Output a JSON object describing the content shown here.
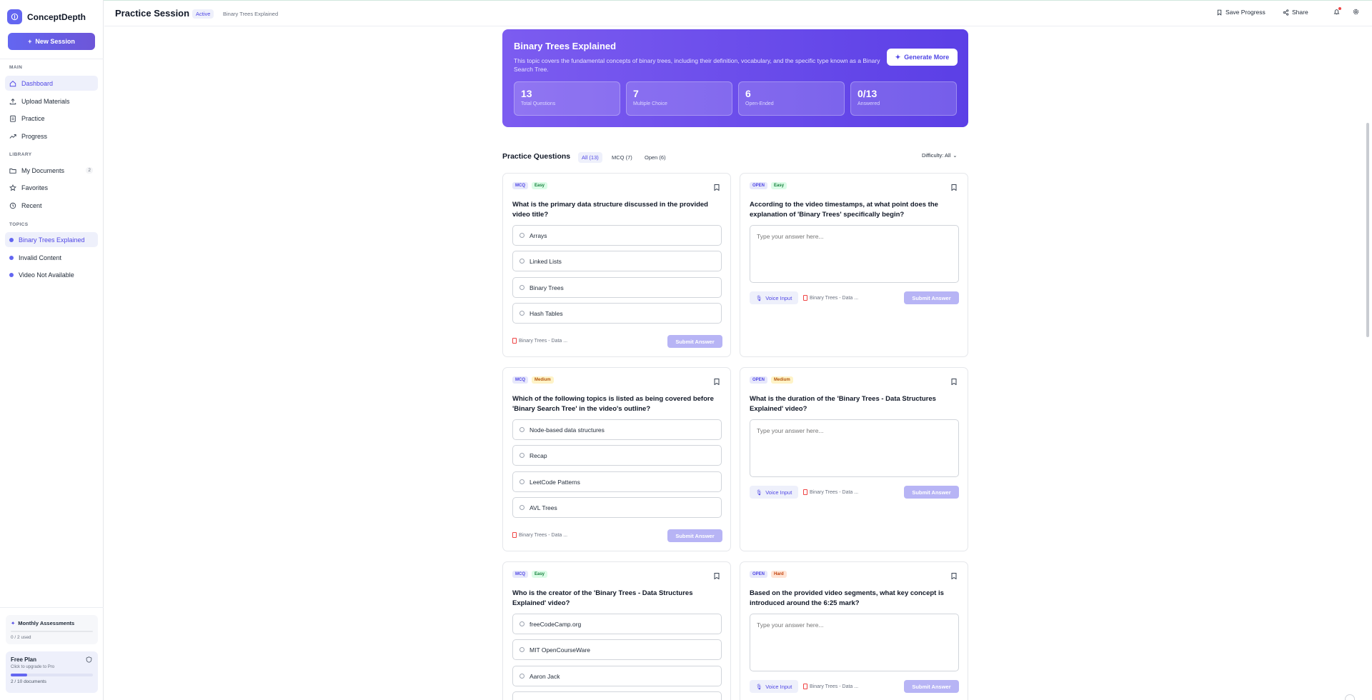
{
  "app": {
    "name": "ConceptDepth"
  },
  "sidebar": {
    "new_session": "New Session",
    "sections": {
      "main": "MAIN",
      "library": "LIBRARY",
      "topics": "TOPICS"
    },
    "main_items": [
      {
        "label": "Dashboard",
        "icon": "home-icon",
        "active": true
      },
      {
        "label": "Upload Materials",
        "icon": "upload-icon"
      },
      {
        "label": "Practice",
        "icon": "clipboard-icon"
      },
      {
        "label": "Progress",
        "icon": "trend-icon"
      }
    ],
    "library_items": [
      {
        "label": "My Documents",
        "icon": "folder-icon",
        "badge": "2"
      },
      {
        "label": "Favorites",
        "icon": "star-icon"
      },
      {
        "label": "Recent",
        "icon": "history-icon"
      }
    ],
    "topics": [
      {
        "label": "Binary Trees Explained",
        "active": true
      },
      {
        "label": "Invalid Content"
      },
      {
        "label": "Video Not Available"
      }
    ],
    "monthly": {
      "title": "Monthly Assessments",
      "usage": "0 / 2 used"
    },
    "plan": {
      "title": "Free Plan",
      "subtitle": "Click to upgrade to Pro",
      "usage": "2 / 10 documents",
      "progress": 0.2
    }
  },
  "header": {
    "title": "Practice Session",
    "status": "Active",
    "crumb": "Binary Trees Explained",
    "save": "Save Progress",
    "share": "Share"
  },
  "hero": {
    "title": "Binary Trees Explained",
    "description": "This topic covers the fundamental concepts of binary trees, including their definition, vocabulary, and the specific type known as a Binary Search Tree.",
    "generate": "Generate More",
    "stats": [
      {
        "value": "13",
        "label": "Total Questions"
      },
      {
        "value": "7",
        "label": "Multiple Choice"
      },
      {
        "value": "6",
        "label": "Open-Ended"
      },
      {
        "value": "0/13",
        "label": "Answered"
      }
    ]
  },
  "questions_header": {
    "title": "Practice Questions",
    "tabs": [
      "All (13)",
      "MCQ (7)",
      "Open (6)"
    ],
    "difficulty": "Difficulty: All"
  },
  "common": {
    "placeholder": "Type your answer here...",
    "voice": "Voice Input",
    "source": "Binary Trees - Data ...",
    "submit": "Submit Answer"
  },
  "questions": [
    {
      "type": "MCQ",
      "difficulty": "Easy",
      "text": "What is the primary data structure discussed in the provided video title?",
      "options": [
        "Arrays",
        "Linked Lists",
        "Binary Trees",
        "Hash Tables"
      ]
    },
    {
      "type": "OPEN",
      "difficulty": "Easy",
      "text": "According to the video timestamps, at what point does the explanation of 'Binary Trees' specifically begin?"
    },
    {
      "type": "MCQ",
      "difficulty": "Medium",
      "text": "Which of the following topics is listed as being covered before 'Binary Search Tree' in the video's outline?",
      "options": [
        "Node-based data structures",
        "Recap",
        "LeetCode Patterns",
        "AVL Trees"
      ]
    },
    {
      "type": "OPEN",
      "difficulty": "Medium",
      "text": "What is the duration of the 'Binary Trees - Data Structures Explained' video?"
    },
    {
      "type": "MCQ",
      "difficulty": "Easy",
      "text": "Who is the creator of the 'Binary Trees - Data Structures Explained' video?",
      "options": [
        "freeCodeCamp.org",
        "MIT OpenCourseWare",
        "Aaron Jack"
      ]
    },
    {
      "type": "OPEN",
      "difficulty": "Hard",
      "text": "Based on the provided video segments, what key concept is introduced around the 6:25 mark?"
    }
  ]
}
